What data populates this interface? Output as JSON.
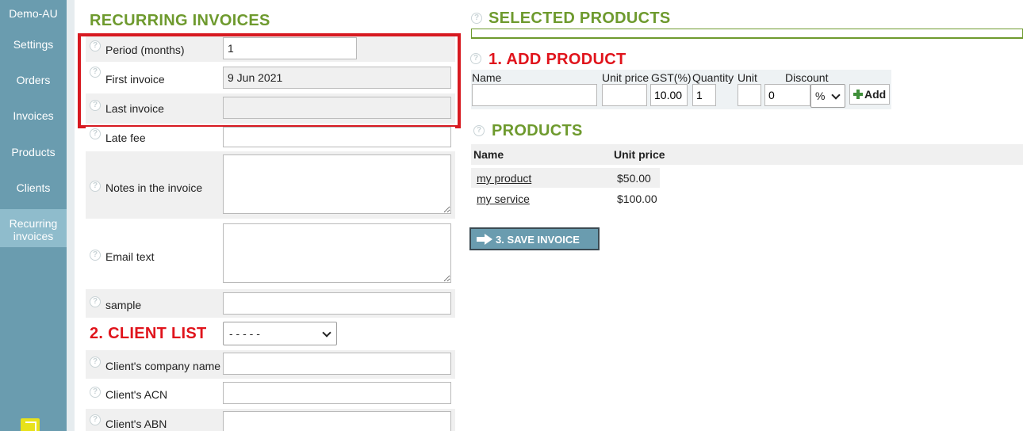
{
  "sidebar": {
    "items": [
      {
        "label": "Demo-AU"
      },
      {
        "label": "Settings"
      },
      {
        "label": "Orders"
      },
      {
        "label": "Invoices"
      },
      {
        "label": "Products"
      },
      {
        "label": "Clients"
      },
      {
        "label": "Recurring invoices",
        "active": true
      }
    ]
  },
  "recurring": {
    "title": "RECURRING INVOICES",
    "period_label": "Period (months)",
    "period_value": "1",
    "first_label": "First invoice",
    "first_value": "9 Jun 2021",
    "last_label": "Last invoice",
    "last_value": "",
    "late_fee_label": "Late fee",
    "late_fee_value": "",
    "notes_label": "Notes in the invoice",
    "email_label": "Email text",
    "sample_label": "sample",
    "sample_value": ""
  },
  "client_list": {
    "title": "2. CLIENT LIST",
    "selected": "- - - - -",
    "company_label": "Client's company name",
    "acn_label": "Client's ACN",
    "abn_label": "Client's ABN"
  },
  "selected_products": {
    "title": "SELECTED PRODUCTS"
  },
  "add_product": {
    "title": "1. ADD PRODUCT",
    "name_label": "Name",
    "unit_price_label": "Unit price",
    "gst_label": "GST(%)",
    "quantity_label": "Quantity",
    "unit_label": "Unit",
    "discount_label": "Discount",
    "gst_value": "10.00",
    "quantity_value": "1",
    "discount_value": "0",
    "discount_type": "%",
    "add_label": "Add"
  },
  "products": {
    "title": "PRODUCTS",
    "col_name": "Name",
    "col_price": "Unit price",
    "rows": [
      {
        "name": "my product",
        "price": "$50.00"
      },
      {
        "name": "my service",
        "price": "$100.00"
      }
    ]
  },
  "save": {
    "label": "3. SAVE INVOICE"
  },
  "colors": {
    "sidebar": "#6a9caf",
    "heading_green": "#6e9a2e",
    "heading_red": "#e0141c",
    "highlight": "#d71920"
  }
}
